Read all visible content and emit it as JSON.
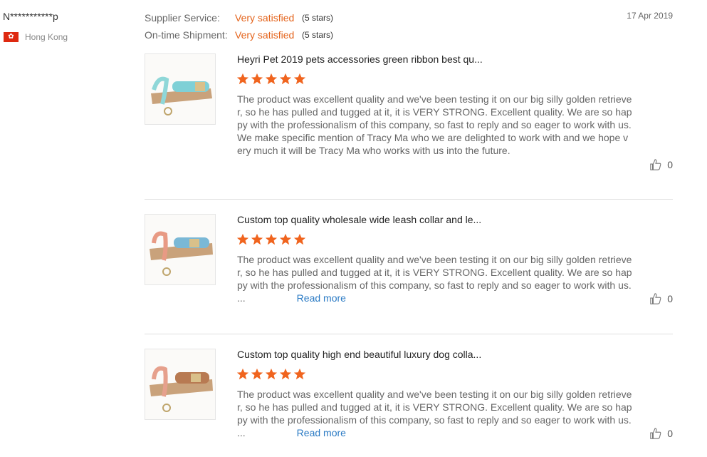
{
  "reviewer": {
    "name": "N***********p",
    "country": "Hong Kong",
    "flag_icon": "hong-kong-flag-icon"
  },
  "ratings": [
    {
      "label": "Supplier Service:",
      "value": "Very satisfied",
      "stars_text": "(5 stars)"
    },
    {
      "label": "On-time Shipment:",
      "value": "Very satisfied",
      "stars_text": "(5 stars)"
    }
  ],
  "date": "17 Apr 2019",
  "products": [
    {
      "title": "Heyri Pet 2019 pets accessories green ribbon best qu...",
      "rating": 5,
      "review": "The product was excellent quality and we've been testing it on our big silly golden retriever, so he has pulled and tugged at it, it is VERY STRONG.  Excellent quality.  We are so happy with the professionalism of this company, so fast to reply and so eager to work with us.  We make specific mention of Tracy Ma who we are delighted to work with and we hope very much it will be Tracy Ma who works with us into the future.",
      "likes": "0"
    },
    {
      "title": "Custom top quality wholesale wide leash collar and le...",
      "rating": 5,
      "review": "The product was excellent quality and we've been testing it on our big silly golden retriever, so he has pulled and tugged at it, it is VERY STRONG.  Excellent quality.  We are so happy with the professionalism of this company, so fast to reply and so eager to work with us.  ...",
      "read_more": "Read more",
      "likes": "0"
    },
    {
      "title": "Custom top quality high end beautiful luxury dog colla...",
      "rating": 5,
      "review": "The product was excellent quality and we've been testing it on our big silly golden retriever, so he has pulled and tugged at it, it is VERY STRONG.  Excellent quality.  We are so happy with the professionalism of this company, so fast to reply and so eager to work with us.  ...",
      "read_more": "Read more",
      "likes": "0"
    }
  ],
  "colors": {
    "accent_orange": "#e4631b",
    "star_orange": "#f0641e",
    "link_blue": "#2a7ac4",
    "flag_red": "#de2910"
  }
}
